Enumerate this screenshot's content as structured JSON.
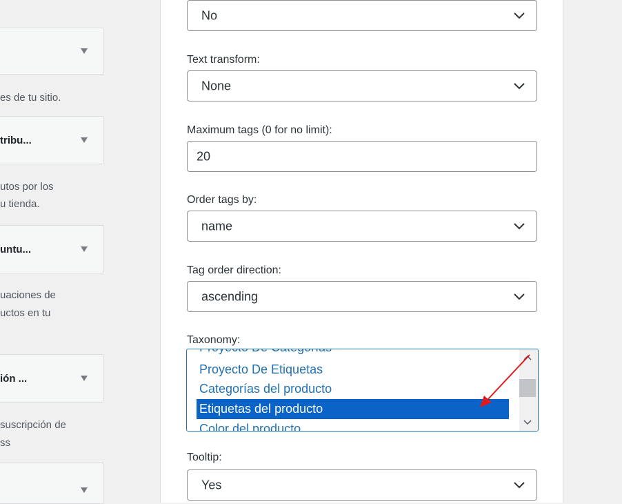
{
  "left_widgets": {
    "items": [
      {
        "title": "",
        "desc": [
          "es de tu sitio."
        ]
      },
      {
        "title": "tribu...",
        "desc": [
          "utos por los",
          "u tienda."
        ]
      },
      {
        "title": "untu...",
        "desc": [
          "uaciones de",
          "uctos en tu"
        ]
      },
      {
        "title": "ión ...",
        "desc": [
          "suscripción de",
          "ss"
        ]
      },
      {
        "title": "",
        "desc": []
      }
    ]
  },
  "form": {
    "top_select_value": "No",
    "text_transform": {
      "label": "Text transform:",
      "value": "None"
    },
    "max_tags": {
      "label": "Maximum tags (0 for no limit):",
      "value": "20"
    },
    "order_by": {
      "label": "Order tags by:",
      "value": "name"
    },
    "order_direction": {
      "label": "Tag order direction:",
      "value": "ascending"
    },
    "taxonomy": {
      "label": "Taxonomy:",
      "options": [
        "Proyecto De Categorías",
        "Proyecto De Etiquetas",
        "Categorías del producto",
        "Etiquetas del producto",
        "Color del producto"
      ],
      "selected": "Etiquetas del producto"
    },
    "tooltip": {
      "label": "Tooltip:",
      "value": "Yes"
    }
  },
  "annotation": {
    "arrow_color": "#e01b1b"
  }
}
